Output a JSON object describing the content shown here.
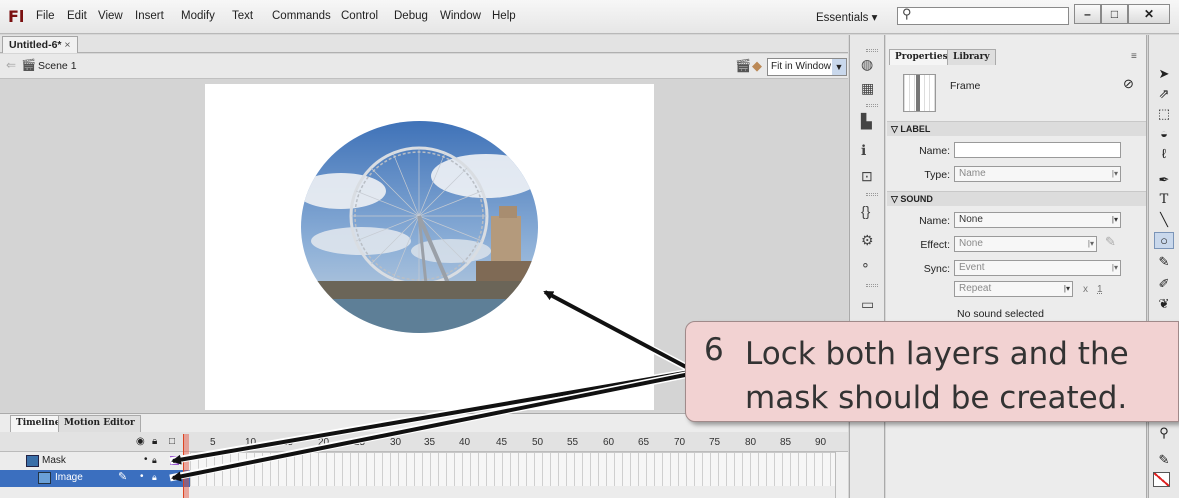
{
  "app": {
    "logo": "Fl"
  },
  "menu": [
    "File",
    "Edit",
    "View",
    "Insert",
    "Modify",
    "Text",
    "Commands",
    "Control",
    "Debug",
    "Window",
    "Help"
  ],
  "workspace": {
    "label": "Essentials"
  },
  "search": {
    "icon": "search-icon"
  },
  "window": {
    "minimize": "minimize-icon",
    "maximize": "maximize-icon",
    "close": "close-icon"
  },
  "document": {
    "tab": "Untitled-6*",
    "close": "×"
  },
  "editbar": {
    "scene": "Scene 1",
    "zoom": "Fit in Window"
  },
  "timeline": {
    "tabs": [
      "Timeline",
      "Motion Editor"
    ],
    "frame_numbers": [
      "5",
      "10",
      "15",
      "20",
      "25",
      "30",
      "35",
      "40",
      "45",
      "50",
      "55",
      "60",
      "65",
      "70",
      "75",
      "80",
      "85",
      "90"
    ],
    "layers": [
      {
        "name": "Mask"
      },
      {
        "name": "Image"
      }
    ]
  },
  "properties": {
    "tabs": [
      "Properties",
      "Library"
    ],
    "type": "Frame",
    "label_section": "LABEL",
    "name_label": "Name:",
    "type_label": "Type:",
    "type_value": "Name",
    "sound_section": "SOUND",
    "sound_name_label": "Name:",
    "sound_name_value": "None",
    "effect_label": "Effect:",
    "effect_value": "None",
    "sync_label": "Sync:",
    "sync_value": "Event",
    "repeat_value": "Repeat",
    "repeat_count_prefix": "x",
    "repeat_count": "1",
    "no_sound": "No sound selected"
  },
  "callout": {
    "number": "6",
    "text": "Lock both layers and the mask should be created."
  },
  "colors": {
    "callout_bg": "#f2d2d2",
    "selected_layer": "#3b6fbf",
    "playhead": "#d42"
  }
}
